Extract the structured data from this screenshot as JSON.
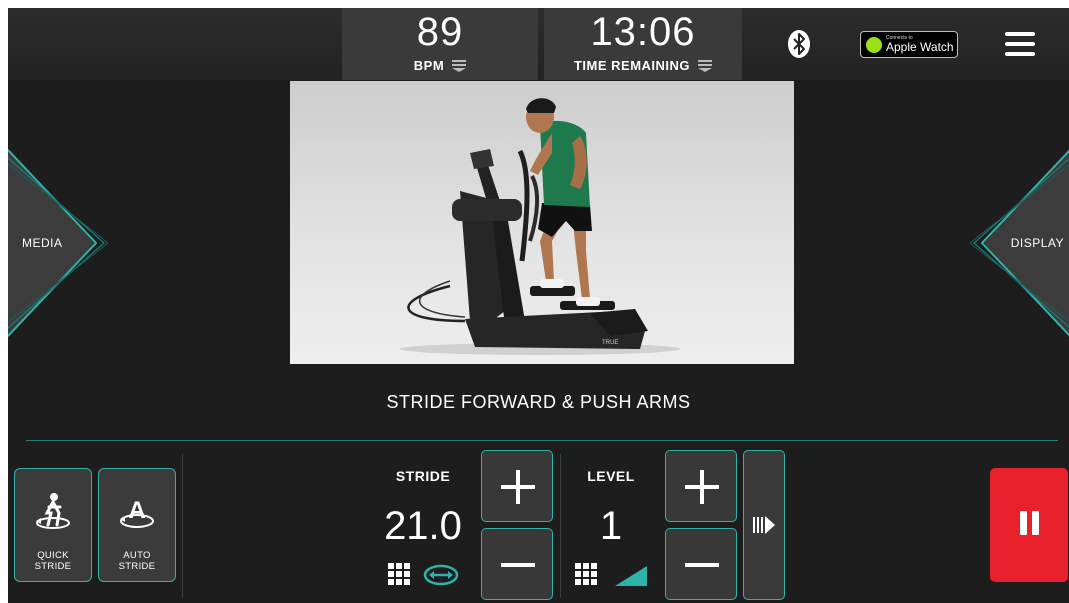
{
  "header": {
    "bpm": {
      "value": "89",
      "label": "BPM"
    },
    "time": {
      "value": "13:06",
      "label": "TIME REMAINING"
    },
    "apple_watch": {
      "small": "Connects to",
      "big": "Apple Watch"
    }
  },
  "side_tabs": {
    "left": "MEDIA",
    "right": "DISPLAY"
  },
  "instruction": "STRIDE FORWARD & PUSH ARMS",
  "modes": {
    "quick": {
      "line1": "QUICK",
      "line2": "STRIDE"
    },
    "auto": {
      "line1": "AUTO",
      "line2": "STRIDE"
    }
  },
  "controls": {
    "stride": {
      "label": "STRIDE",
      "value": "21.0"
    },
    "level": {
      "label": "LEVEL",
      "value": "1"
    }
  },
  "video": {
    "brand": "TRUE"
  },
  "colors": {
    "accent": "#2fb3a9",
    "pause": "#e8202a",
    "background": "#1d1d1d",
    "apple_watch_dot": "#9be015"
  },
  "icons": [
    "bluetooth-icon",
    "menu-icon",
    "quick-stride-icon",
    "auto-stride-icon",
    "plus-icon",
    "minus-icon",
    "grid-icon",
    "stride-range-icon",
    "incline-icon",
    "next-segment-icon",
    "pause-icon"
  ]
}
